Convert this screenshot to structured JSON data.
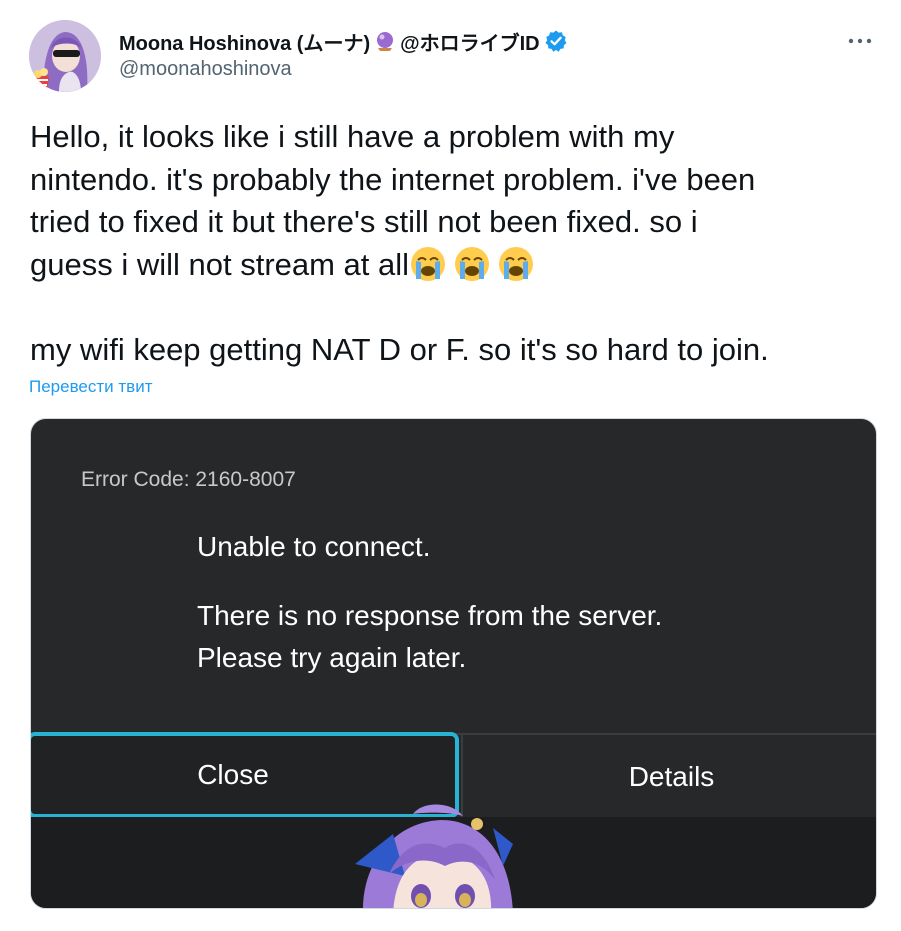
{
  "author": {
    "display_name": "Moona Hoshinova (ムーナ)",
    "affiliation": "@ホロライブID",
    "handle": "@moonahoshinova",
    "avatar_icon": "avatar-image",
    "orb_icon": "crystal-ball-icon",
    "verified_icon": "verified-badge-icon",
    "verified_color": "#1d9bf0"
  },
  "more_icon": "more-options-icon",
  "tweet": {
    "line1": "Hello, it looks like i still have a problem with my",
    "line2": "nintendo. it's probably the internet problem. i've been",
    "line3": "tried to fixed it but there's still not been fixed. so i",
    "line4": "guess i will not stream at all",
    "emoji": "loudly-crying-face-icon",
    "line5": "my wifi keep getting NAT D or F. so it's so hard to join."
  },
  "translate_label": "Перевести твит",
  "media": {
    "error_code": "Error Code: 2160-8007",
    "title": "Unable to connect.",
    "message_line1": "There is no response from the server.",
    "message_line2": "Please try again later.",
    "close_label": "Close",
    "details_label": "Details",
    "highlight_color": "#27b3d4"
  }
}
